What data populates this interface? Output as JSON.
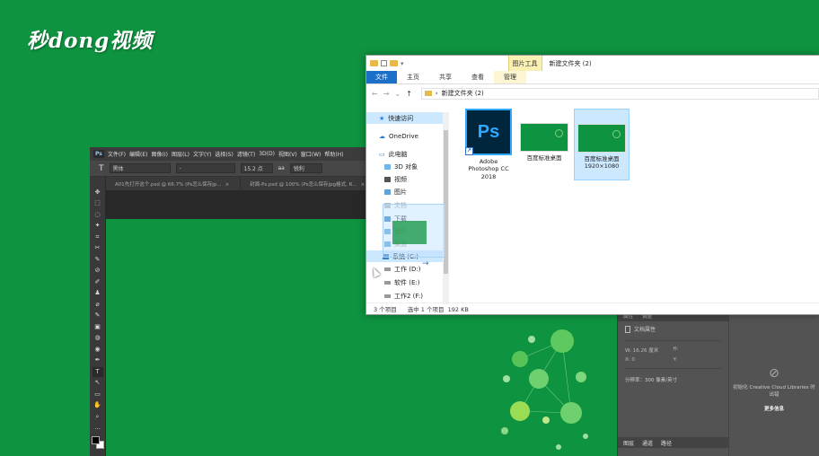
{
  "watermark": "秒dong视频",
  "photoshop": {
    "logo": "Ps",
    "menu": [
      "文件(F)",
      "编辑(E)",
      "图像(I)",
      "图层(L)",
      "文字(Y)",
      "选择(S)",
      "滤镜(T)",
      "3D(D)",
      "视图(V)",
      "窗口(W)",
      "帮助(H)"
    ],
    "options": {
      "tool": "T",
      "font": "黑体",
      "style": "-",
      "size": "15.2 点",
      "antialias": "aa",
      "sharp": "锐利"
    },
    "tabs": [
      "A01先打开这个.psd @ 66.7% (Ps怎么保存jp...",
      "封面-Ps.psd @ 100% (Ps怎么保存jpg格式, R..."
    ],
    "tab_close": "×",
    "tools": [
      "✥",
      "⬚",
      "◌",
      "✦",
      "⌗",
      "✂",
      "✎",
      "⊘",
      "✐",
      "♟",
      "⌀",
      "✎",
      "▣",
      "◍",
      "◉",
      "✒",
      "T",
      "↖",
      "▭",
      "✋",
      "⌕",
      "…"
    ]
  },
  "properties_panel": {
    "tabs": [
      "属性",
      "调整"
    ],
    "doc_title": "文档属性",
    "w_label": "W:",
    "w_value": "16.26 厘米",
    "h_label": "H:",
    "x_label": "X:",
    "x_value": "0",
    "y_label": "Y:",
    "resolution": "分辨率：300 像素/英寸",
    "bottom_tabs": [
      "图层",
      "通道",
      "路径"
    ]
  },
  "libraries": {
    "message": "初始化 Creative Cloud Libraries 时出错",
    "link": "更多信息"
  },
  "explorer": {
    "context_tab": "图片工具",
    "title": "新建文件夹 (2)",
    "ribbon": [
      "文件",
      "主页",
      "共享",
      "查看",
      "管理"
    ],
    "nav_arrows": [
      "←",
      "→",
      "⌄",
      "↑"
    ],
    "breadcrumb_sep": "›",
    "address": "新建文件夹 (2)",
    "nav": {
      "quick": "快速访问",
      "onedrive": "OneDrive",
      "pc": "此电脑",
      "items": [
        "3D 对象",
        "视频",
        "图片",
        "文档",
        "下载",
        "音乐",
        "桌面"
      ],
      "drives": [
        "系统 (C:)",
        "工作 (D:)",
        "软件 (E:)",
        "工作2 (F:)"
      ]
    },
    "files": [
      {
        "name": "Adobe Photoshop CC 2018",
        "icon": "photoshop-icon"
      },
      {
        "name": "百度标准桌面",
        "icon": "image-thumbnail"
      },
      {
        "name": "百度标准桌面 1920×1080",
        "icon": "image-thumbnail"
      }
    ],
    "ps_icon_text": "Ps",
    "shortcut_arrow": "↗",
    "status": {
      "count": "3 个项目",
      "selected": "选中 1 个项目",
      "size": "192 KB"
    }
  },
  "drag_arrow": "→"
}
